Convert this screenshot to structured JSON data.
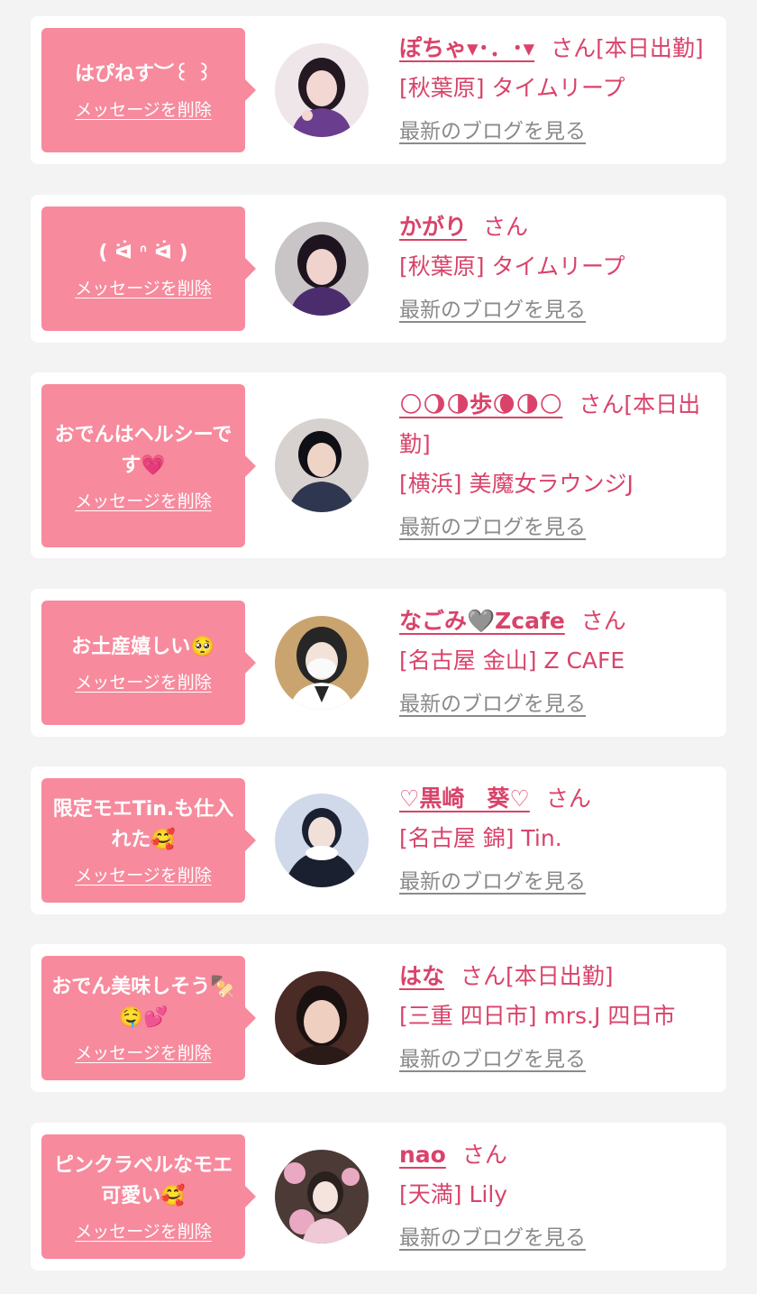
{
  "favorites": [
    {
      "message": "はぴねす︶꒰ ꒱",
      "delete_label": "メッセージを削除",
      "name": "ぽちゃ▾･．･▾",
      "honorific": "さん",
      "status": "[本日出勤]",
      "shop": "[秋葉原] タイムリープ",
      "blog_link": "最新のブログを見る",
      "avatar_colors": [
        "#6a3d8f",
        "#f2d7d3",
        "#2a1a2e"
      ]
    },
    {
      "message": "( ᐛ ᐢ ᐛ )",
      "delete_label": "メッセージを削除",
      "name": "かがり",
      "honorific": "さん",
      "status": "",
      "shop": "[秋葉原] タイムリープ",
      "blog_link": "最新のブログを見る",
      "avatar_colors": [
        "#4b2d6e",
        "#efd3cc",
        "#1d1420"
      ]
    },
    {
      "message": "おでんはヘルシーです💗",
      "delete_label": "メッセージを削除",
      "name": "🌕🌖🌗歩🌘🌗🌕",
      "honorific": "さん",
      "status": "[本日出勤]",
      "shop": "[横浜] 美魔女ラウンジJ",
      "blog_link": "最新のブログを見る",
      "avatar_colors": [
        "#2f3650",
        "#edd4c7",
        "#0f0f15"
      ]
    },
    {
      "message": "お土産嬉しい🥺",
      "delete_label": "メッセージを削除",
      "name": "なごみ🩶Zcafe",
      "honorific": "さん",
      "status": "",
      "shop": "[名古屋 金山] Z CAFE",
      "blog_link": "最新のブログを見る",
      "avatar_colors": [
        "#caa46e",
        "#fafafa",
        "#262626"
      ]
    },
    {
      "message": "限定モエTin.も仕入れた🥰",
      "delete_label": "メッセージを削除",
      "name": "♡黒崎　葵♡",
      "honorific": "さん",
      "status": "",
      "shop": "[名古屋 錦] Tin.",
      "blog_link": "最新のブログを見る",
      "avatar_colors": [
        "#cfd9ea",
        "#f0e0d8",
        "#1b2030"
      ]
    },
    {
      "message": "おでん美味しそう🍢🤤💕",
      "delete_label": "メッセージを削除",
      "name": "はな",
      "honorific": "さん",
      "status": "[本日出勤]",
      "shop": "[三重 四日市] mrs.J 四日市",
      "blog_link": "最新のブログを見る",
      "avatar_colors": [
        "#4a2b25",
        "#efcfc0",
        "#1a1210"
      ]
    },
    {
      "message": "ピンクラベルなモエ可愛い🥰",
      "delete_label": "メッセージを削除",
      "name": "nao",
      "honorific": "さん",
      "status": "",
      "shop": "[天満] Lily",
      "blog_link": "最新のブログを見る",
      "avatar_colors": [
        "#e9a9c2",
        "#f5e3de",
        "#4b3a36"
      ]
    }
  ]
}
